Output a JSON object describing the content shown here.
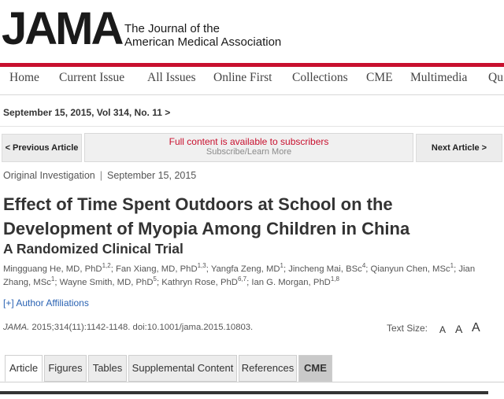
{
  "header": {
    "logo": "JAMA",
    "journal_line1": "The Journal of the",
    "journal_line2": "American Medical Association"
  },
  "nav": {
    "items": [
      "Home",
      "Current Issue",
      "All Issues",
      "Online First",
      "Collections",
      "CME",
      "Multimedia",
      "Qu"
    ]
  },
  "issue": {
    "label": "September 15, 2015, Vol 314, No. 11 >"
  },
  "article_nav": {
    "prev": "< Previous Article",
    "next": "Next Article >",
    "subscribe_notice": "Full content is available to subscribers",
    "subscribe_link": "Subscribe/Learn More"
  },
  "meta": {
    "type": "Original Investigation",
    "separator": "|",
    "date": "September 15, 2015"
  },
  "article": {
    "title": "Effect of Time Spent Outdoors at School on the Development of Myopia Among Children in China",
    "subtitle": "A Randomized Clinical Trial",
    "authors": [
      {
        "name": "Mingguang He, MD, PhD",
        "sup": "1,2"
      },
      {
        "name": "Fan Xiang, MD, PhD",
        "sup": "1,3"
      },
      {
        "name": "Yangfa Zeng, MD",
        "sup": "1"
      },
      {
        "name": "Jincheng Mai, BSc",
        "sup": "4"
      },
      {
        "name": "Qianyun Chen, MSc",
        "sup": "1"
      },
      {
        "name": "Jian Zhang, MSc",
        "sup": "1"
      },
      {
        "name": "Wayne Smith, MD, PhD",
        "sup": "5"
      },
      {
        "name": "Kathryn Rose, PhD",
        "sup": "6,7"
      },
      {
        "name": "Ian G. Morgan, PhD",
        "sup": "1,8"
      }
    ],
    "affiliations_link": "[+] Author Affiliations",
    "citation_journal": "JAMA.",
    "citation_rest": " 2015;314(11):1142-1148. doi:10.1001/jama.2015.10803."
  },
  "text_size": {
    "label": "Text Size:",
    "small": "A",
    "medium": "A",
    "large": "A"
  },
  "tabs": [
    "Article",
    "Figures",
    "Tables",
    "Supplemental Content",
    "References",
    "CME"
  ],
  "colors": {
    "brand_red": "#c8102e",
    "link_blue": "#2a63b3"
  }
}
